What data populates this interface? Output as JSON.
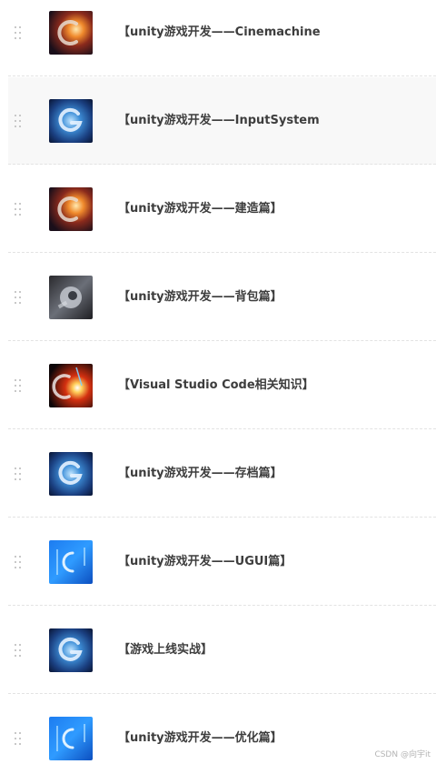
{
  "columns": [
    {
      "title": "【unity游戏开发——Cinemachine篇】",
      "thumb": "fire-ring-thumbnail"
    },
    {
      "title": "【unity游戏开发——InputSystem篇】",
      "thumb": "blue-swirl-thumbnail",
      "hover": true
    },
    {
      "title": "【unity游戏开发——建造篇】",
      "thumb": "fire-ring-thumbnail"
    },
    {
      "title": "【unity游戏开发——背包篇】",
      "thumb": "astronaut-thumbnail"
    },
    {
      "title": "【Visual Studio Code相关知识】",
      "thumb": "red-explosion-thumbnail"
    },
    {
      "title": "【unity游戏开发——存档篇】",
      "thumb": "blue-swirl-thumbnail"
    },
    {
      "title": "【unity游戏开发——UGUI篇】",
      "thumb": "blue-light-thumbnail"
    },
    {
      "title": "【游戏上线实战】",
      "thumb": "blue-swirl-thumbnail"
    },
    {
      "title": "【unity游戏开发——优化篇】",
      "thumb": "blue-light-thumbnail"
    }
  ],
  "watermark": "CSDN @向宇it",
  "colors": {
    "title": "#3d3d3d",
    "divider": "#e3e3e3",
    "hover_bg": "#f8f8f8",
    "handle": "#c8c8c8"
  }
}
